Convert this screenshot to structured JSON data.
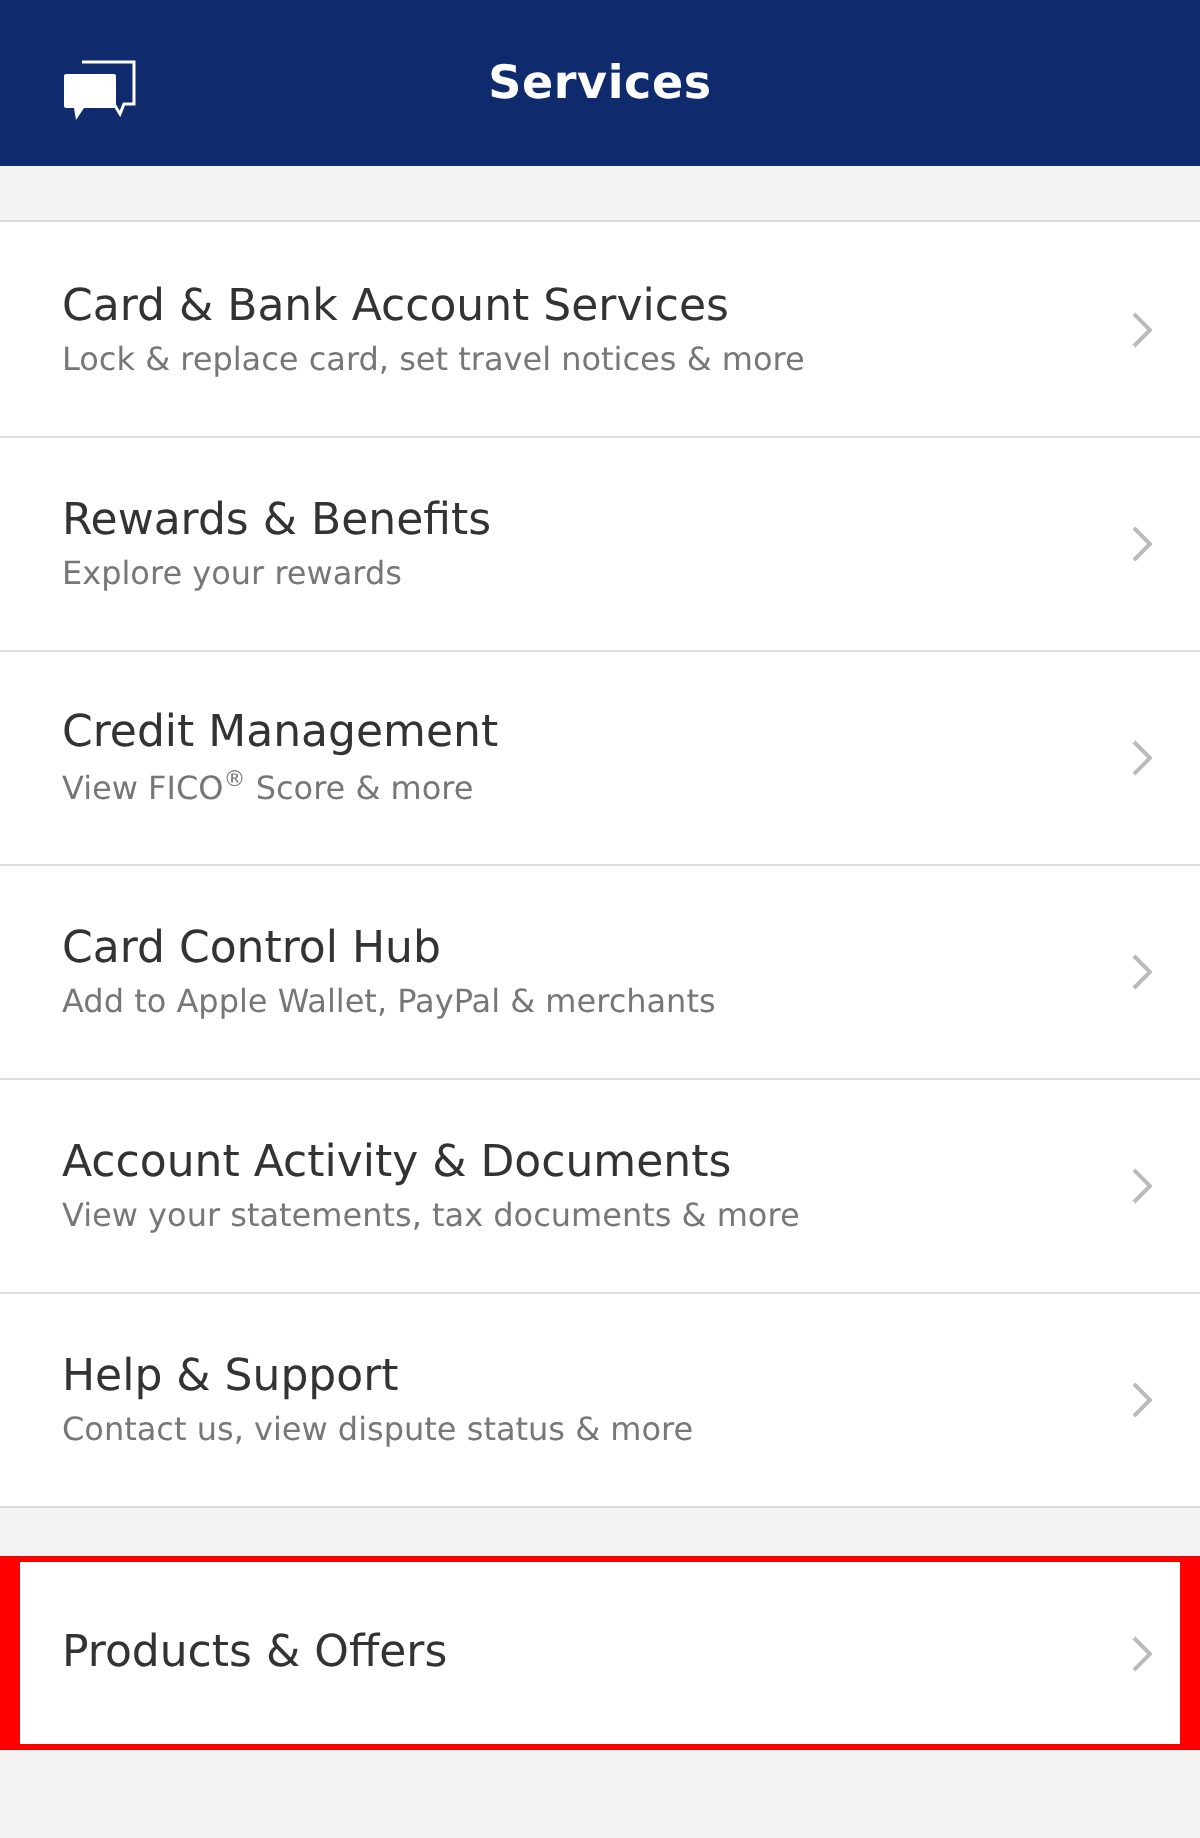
{
  "header": {
    "title": "Services"
  },
  "menu": [
    {
      "title": "Card & Bank Account Services",
      "subtitle": "Lock & replace card, set travel notices & more"
    },
    {
      "title": "Rewards & Benefits",
      "subtitle": "Explore your rewards"
    },
    {
      "title": "Credit Management",
      "subtitle": "View FICO$^{®}$ Score & more"
    },
    {
      "title": "Card Control Hub",
      "subtitle": "Add to Apple Wallet, PayPal & merchants"
    },
    {
      "title": "Account Activity & Documents",
      "subtitle": "View your statements, tax documents & more"
    },
    {
      "title": "Help & Support",
      "subtitle": "Contact us, view dispute status & more"
    }
  ],
  "extra_menu": [
    {
      "title": "Products & Offers",
      "highlighted": true
    }
  ]
}
